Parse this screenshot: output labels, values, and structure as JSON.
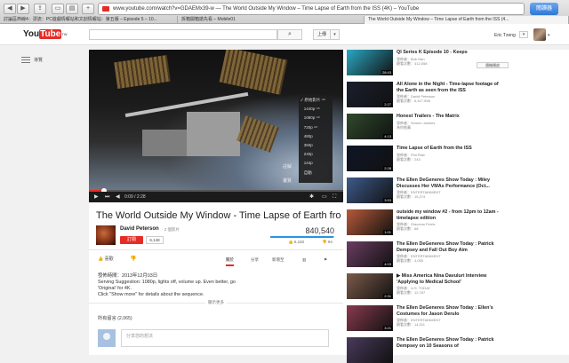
{
  "browser": {
    "url": "www.youtube.com/watch?v=GDAEMx39-w ― The World Outside My Window ‒ Time Lapse of Earth from the ISS (4K) ‒ YouTube",
    "reader_label": "閱讀器",
    "tabs": [
      "討論區熱線4：漂流：PC遊戲情報站和文創情報站：第五版 – Episode 5 – 10...",
      "拆箱開箱搶先看 – Mobile01",
      "The World Outside My Window ‒ Time Lapse of Earth from the ISS (4..."
    ]
  },
  "header": {
    "logo_you": "You",
    "logo_tube": "Tube",
    "logo_tm": "TW",
    "search_icon": "⌕",
    "upload_label": "上傳",
    "dropdown_glyph": "▾",
    "username": "Eric Tzeng"
  },
  "guide": {
    "label": "導覽"
  },
  "player": {
    "time": "0:09 / 2:28",
    "progress": 0.06,
    "quality_menu": [
      "原始影片",
      "1440p",
      "1080p",
      "720p",
      "480p",
      "360p",
      "240p",
      "144p",
      "自動"
    ],
    "quality_hd": [
      "HD",
      "HD",
      "HD",
      "HD",
      "",
      "",
      "",
      "",
      ""
    ],
    "captions_label": "註解",
    "quality_label": "畫質",
    "current_quality": "原始影片"
  },
  "video": {
    "title": "The World Outside My Window - Time Lapse of Earth from the IS...",
    "channel": "David Peterson",
    "channel_videos": "· 2 個影片",
    "subscribe_label": "訂閱",
    "subscriber_count": "6,148",
    "views": "840,540",
    "like_ratio": 0.98,
    "likes": "6,182",
    "dislikes": "94",
    "like_button": "喜歡",
    "tabs": [
      "關於",
      "分享",
      "新增至",
      "",
      ""
    ],
    "published": "發佈時間：2013年12月03日",
    "description": [
      "Serving Suggestion: 1080p, lights off, volume up. Even better, go",
      "'Original' for 4K.",
      "Click \"Show more\" for details about the sequence."
    ],
    "show_more": "顯示更多",
    "comments_header": "所有留言 (2,065)",
    "comment_placeholder": "分享您的想法"
  },
  "related": {
    "dropdown": "隨機播放",
    "items": [
      {
        "title": "QI Series K Episode 10 - Keeps",
        "by": "發佈者：Bob Nan",
        "views": "觀看次數：412,558",
        "duration": "28:43",
        "thumb": "#2aa8c4"
      },
      {
        "title": "All Alone in the Night - Time-lapse footage of the Earth as seen from the ISS",
        "by": "發佈者：David Peterson",
        "views": "觀看次數：6,417,596",
        "duration": "2:27",
        "thumb": "#1a1f2e"
      },
      {
        "title": "Honest Trailers - The Matrix",
        "by": "發佈者：Screen Junkies",
        "views": "為你推薦",
        "duration": "4:13",
        "thumb": "#2f4a2c"
      },
      {
        "title": "Time Lapse of Earth from the ISS",
        "by": "發佈者：Phil Plait",
        "views": "觀看次數：243",
        "duration": "2:28",
        "thumb": "#0e1626"
      },
      {
        "title": "The Ellen DeGeneres Show Today : Miley Discusses Her VMAs Performance (Oct...",
        "by": "發佈者：ENTERTAINMENT",
        "views": "觀看次數：15,274",
        "duration": "3:53",
        "thumb": "#3d5a8a"
      },
      {
        "title": "outside my window #2 - from 12pm to 12am - timelapse edition",
        "by": "發佈者：Giacomo Ferris",
        "views": "觀看次數：68",
        "duration": "1:01",
        "thumb": "#b75a3a"
      },
      {
        "title": "The Ellen DeGeneres Show Today : Patrick Dempsey and Fall Out Boy Aim",
        "by": "發佈者：ENTERTAINMENT",
        "views": "觀看次數：4,055",
        "duration": "4:03",
        "thumb": "#6b3d62"
      },
      {
        "title": "▶ Miss America Nina Davuluri Interview 'Applying to Medical School'",
        "by": "發佈者：U.S. TODAY",
        "views": "觀看次數：12,787",
        "duration": "2:31",
        "thumb": "#7c5a4a"
      },
      {
        "title": "The Ellen DeGeneres Show Today : Ellen's Costumes for Jason Derulo",
        "by": "發佈者：ENTERTAINMENT",
        "views": "觀看次數：14,311",
        "duration": "3:21",
        "thumb": "#8a3a4f"
      },
      {
        "title": "The Ellen DeGeneres Show Today : Patrick Dempsey on 10 Seasons of",
        "by": "",
        "views": "",
        "duration": "",
        "thumb": "#4a3a5c"
      }
    ]
  }
}
